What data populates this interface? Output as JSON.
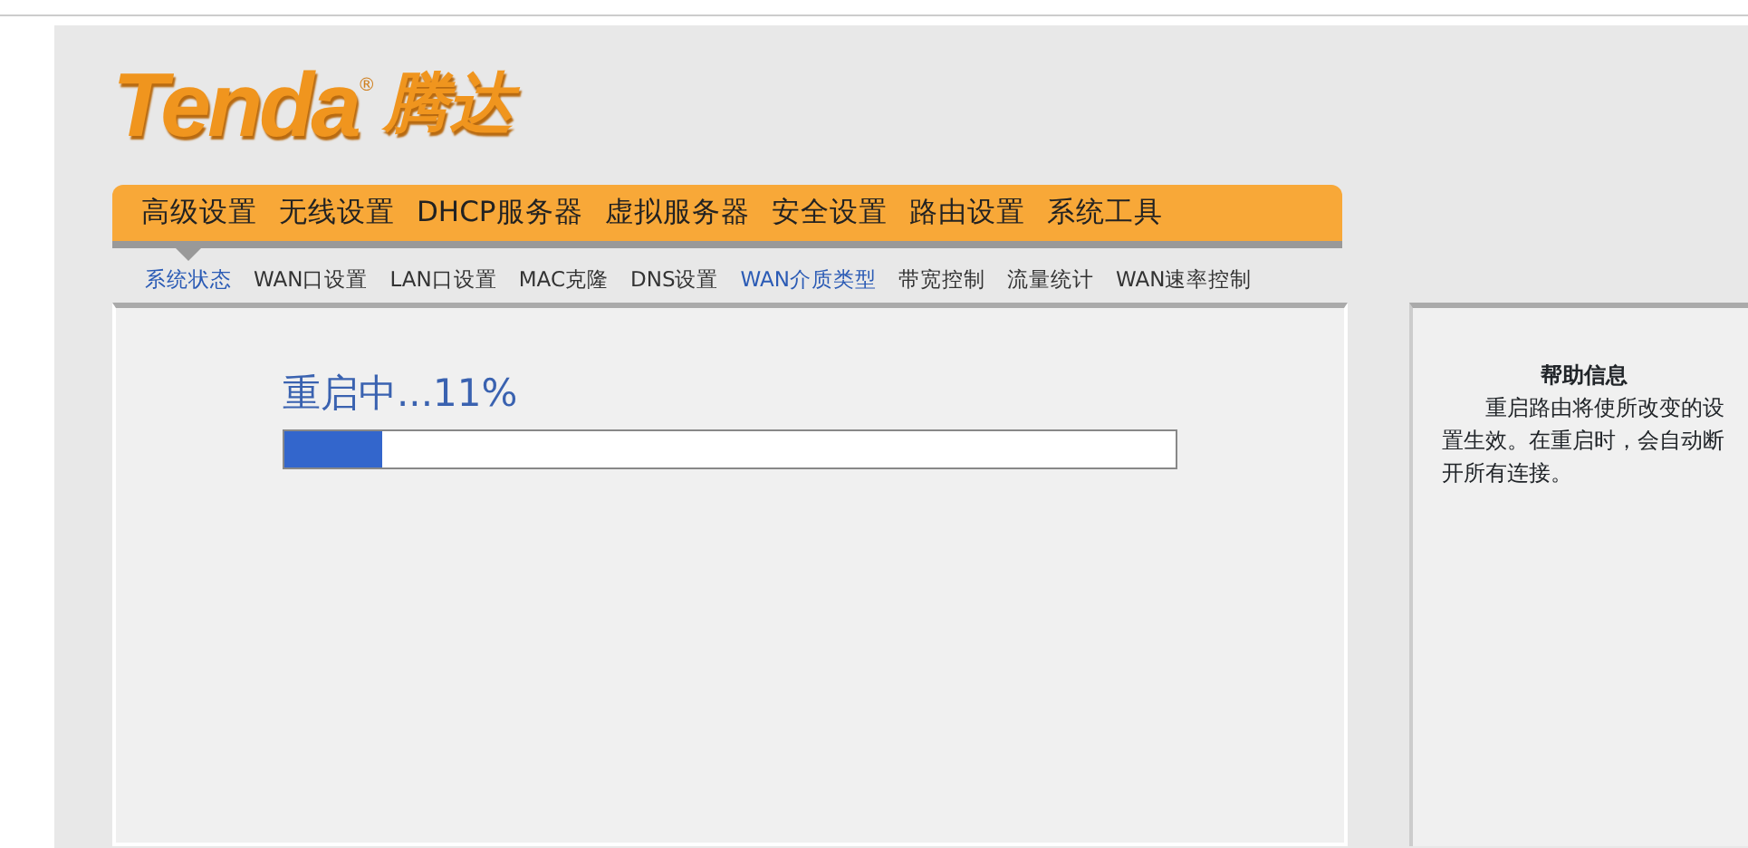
{
  "logo": {
    "wordmark": "Tenda",
    "registered": "®",
    "chinese": "腾达"
  },
  "main_menu": [
    {
      "label": "高级设置"
    },
    {
      "label": "无线设置"
    },
    {
      "label": "DHCP服务器"
    },
    {
      "label": "虚拟服务器"
    },
    {
      "label": "安全设置"
    },
    {
      "label": "路由设置"
    },
    {
      "label": "系统工具"
    }
  ],
  "sub_menu": [
    {
      "label": "系统状态",
      "selected": true,
      "visited": true
    },
    {
      "label": "WAN口设置",
      "selected": false,
      "visited": false
    },
    {
      "label": "LAN口设置",
      "selected": false,
      "visited": false
    },
    {
      "label": "MAC克隆",
      "selected": false,
      "visited": false
    },
    {
      "label": "DNS设置",
      "selected": false,
      "visited": false
    },
    {
      "label": "WAN介质类型",
      "selected": false,
      "visited": true
    },
    {
      "label": "带宽控制",
      "selected": false,
      "visited": false
    },
    {
      "label": "流量统计",
      "selected": false,
      "visited": false
    },
    {
      "label": "WAN速率控制",
      "selected": false,
      "visited": false
    }
  ],
  "progress": {
    "text": "重启中...11%",
    "level": 0.11
  },
  "help": {
    "title": "帮助信息",
    "text": "重启路由将使所改变的设置生效。在重启时，会自动断开所有连接。"
  }
}
